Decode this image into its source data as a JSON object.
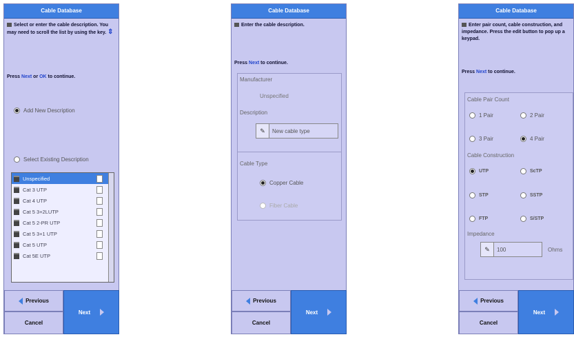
{
  "panel1": {
    "title": "Cable Database",
    "instruction": "Select or enter the cable description. You may need to scroll the list by using the key.",
    "press_prefix": "Press ",
    "press_kw1": "Next",
    "press_or": " or ",
    "press_kw2": "OK",
    "press_suffix": " to continue.",
    "opt_add": "Add New Description",
    "opt_select": "Select Existing Description",
    "list": [
      {
        "label": "Unspecified",
        "selected": true
      },
      {
        "label": "Cat 3 UTP",
        "selected": false
      },
      {
        "label": "Cat 4 UTP",
        "selected": false
      },
      {
        "label": "Cat 5 3+2LUTP",
        "selected": false
      },
      {
        "label": "Cat 5 2-PR UTP",
        "selected": false
      },
      {
        "label": "Cat 5 3+1 UTP",
        "selected": false
      },
      {
        "label": "Cat 5 UTP",
        "selected": false
      },
      {
        "label": "Cat 5E UTP",
        "selected": false
      }
    ],
    "prev": "Previous",
    "next": "Next",
    "cancel": "Cancel"
  },
  "panel2": {
    "title": "Cable Database",
    "instruction": "Enter the cable description.",
    "press_prefix": "Press ",
    "press_kw1": "Next",
    "press_suffix": " to continue.",
    "manufacturer_label": "Manufacturer",
    "manufacturer_value": "Unspecified",
    "description_label": "Description",
    "description_value": "New cable type",
    "cable_type_label": "Cable Type",
    "opt_copper": "Copper Cable",
    "opt_fiber": "Fiber Cable",
    "prev": "Previous",
    "next": "Next",
    "cancel": "Cancel"
  },
  "panel3": {
    "title": "Cable Database",
    "instruction": "Enter pair count, cable construction, and impedance. Press the edit button to pop up a keypad.",
    "press_prefix": "Press ",
    "press_kw1": "Next",
    "press_suffix": " to continue.",
    "pair_count_label": "Cable Pair Count",
    "pairs": [
      "1 Pair",
      "2 Pair",
      "3 Pair",
      "4 Pair"
    ],
    "construction_label": "Cable Construction",
    "constructions": [
      "UTP",
      "ScTP",
      "STP",
      "SSTP",
      "FTP",
      "S/STP"
    ],
    "impedance_label": "Impedance",
    "impedance_value": "100",
    "impedance_unit": "Ohms",
    "prev": "Previous",
    "next": "Next",
    "cancel": "Cancel"
  }
}
